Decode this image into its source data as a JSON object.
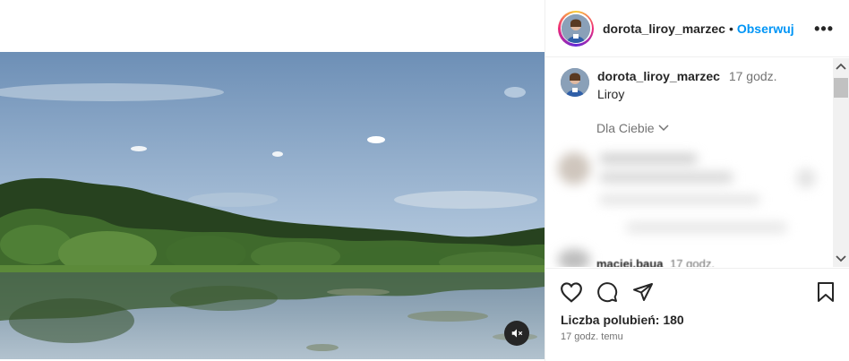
{
  "post": {
    "username": "dorota_liroy_marzec",
    "follow_label": "Obserwuj",
    "separator": "•",
    "more_label": "•••"
  },
  "caption": {
    "username": "dorota_liroy_marzec",
    "time": "17 godz.",
    "text": "Liroy"
  },
  "comments": {
    "filter_label": "Dla Ciebie",
    "partial_username": "maciej.baua",
    "partial_time": "17 godz."
  },
  "stats": {
    "likes_text": "Liczba polubień: 180",
    "posted_ago": "17 godz. temu"
  },
  "icons": {
    "like": "heart-icon",
    "comment": "comment-icon",
    "share": "send-icon",
    "save": "bookmark-icon",
    "more": "more-icon",
    "mute": "muted-speaker-icon"
  },
  "colors": {
    "follow": "#0095f6",
    "text": "#262626",
    "muted_text": "#737373"
  }
}
